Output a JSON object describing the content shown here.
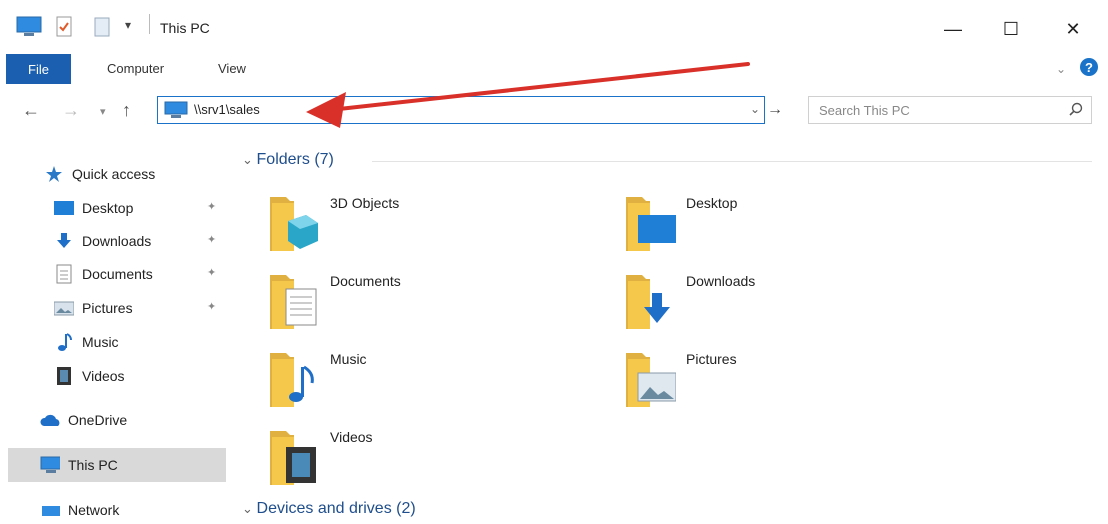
{
  "window": {
    "title": "This PC",
    "minimize_label": "—",
    "maximize_label": "☐",
    "close_label": "✕"
  },
  "ribbon": {
    "tabs": [
      "File",
      "Computer",
      "View"
    ]
  },
  "address_bar": {
    "path": "\\\\srv1\\sales"
  },
  "search": {
    "placeholder": "Search This PC"
  },
  "nav_pane": {
    "quick_access": "Quick access",
    "items": [
      "Desktop",
      "Downloads",
      "Documents",
      "Pictures",
      "Music",
      "Videos"
    ],
    "onedrive": "OneDrive",
    "this_pc": "This PC",
    "network": "Network"
  },
  "content": {
    "folders_header": "Folders (7)",
    "folders": [
      "3D Objects",
      "Desktop",
      "Documents",
      "Downloads",
      "Music",
      "Pictures",
      "Videos"
    ],
    "devices_header": "Devices and drives (2)"
  },
  "colors": {
    "accent": "#1a5fb0",
    "annotation_arrow": "#d9302a",
    "folder": "#f5c84b"
  }
}
